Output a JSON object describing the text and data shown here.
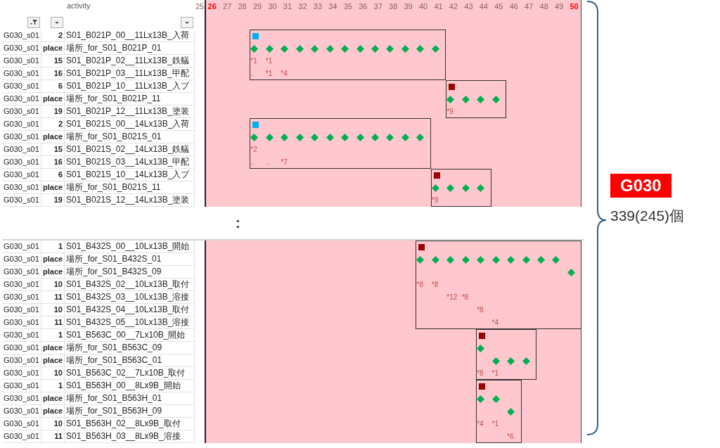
{
  "sheets": [
    {
      "columns": [
        {
          "filtered": true
        },
        {
          "filtered": false
        },
        {
          "title": "activity",
          "filtered": false
        }
      ],
      "days": [
        {
          "label": "25",
          "highlight": false
        },
        {
          "label": "26",
          "highlight": true
        },
        {
          "label": "27",
          "highlight": false
        },
        {
          "label": "28",
          "highlight": false
        },
        {
          "label": "29",
          "highlight": false
        },
        {
          "label": "30",
          "highlight": false
        },
        {
          "label": "31",
          "highlight": false
        },
        {
          "label": "32",
          "highlight": false
        },
        {
          "label": "33",
          "highlight": false
        },
        {
          "label": "34",
          "highlight": false
        },
        {
          "label": "35",
          "highlight": false
        },
        {
          "label": "36",
          "highlight": false
        },
        {
          "label": "37",
          "highlight": false
        },
        {
          "label": "38",
          "highlight": false
        },
        {
          "label": "39",
          "highlight": false
        },
        {
          "label": "40",
          "highlight": false
        },
        {
          "label": "41",
          "highlight": false
        },
        {
          "label": "42",
          "highlight": false
        },
        {
          "label": "43",
          "highlight": false
        },
        {
          "label": "44",
          "highlight": false
        },
        {
          "label": "45",
          "highlight": false
        },
        {
          "label": "46",
          "highlight": false
        },
        {
          "label": "47",
          "highlight": false
        },
        {
          "label": "48",
          "highlight": false
        },
        {
          "label": "49",
          "highlight": false
        },
        {
          "label": "50",
          "highlight": true
        }
      ],
      "groups": [
        {
          "rows": [
            {
              "id": "G030_s01",
              "number": "2",
              "activity": "S01_B021P_00__11Lx13B_入荷",
              "cells": [
                null,
                null,
                null,
                null,
                {
                  "kind": "square",
                  "color": "#00b0f0"
                }
              ]
            },
            {
              "id": "G030_s01",
              "number": "place",
              "activity": "場所_for_S01_B021P_01",
              "cells": [
                null,
                null,
                null,
                null,
                {
                  "kind": "diamond"
                },
                {
                  "kind": "diamond"
                },
                {
                  "kind": "diamond"
                },
                {
                  "kind": "diamond"
                },
                {
                  "kind": "diamond"
                },
                {
                  "kind": "diamond"
                },
                {
                  "kind": "diamond"
                },
                {
                  "kind": "diamond"
                },
                {
                  "kind": "diamond"
                },
                {
                  "kind": "diamond"
                },
                {
                  "kind": "diamond"
                },
                {
                  "kind": "diamond"
                },
                {
                  "kind": "diamond"
                }
              ]
            },
            {
              "id": "G030_s01",
              "number": "15",
              "activity": "S01_B021P_02__11Lx13B_鉄艤",
              "cells": [
                null,
                null,
                null,
                null,
                {
                  "kind": "note",
                  "text": "*1"
                },
                {
                  "kind": "note",
                  "text": "*1"
                }
              ]
            },
            {
              "id": "G030_s01",
              "number": "16",
              "activity": "S01_B021P_03__11Lx13B_甲配",
              "cells": [
                null,
                null,
                null,
                null,
                {
                  "kind": "note",
                  "text": ".."
                },
                {
                  "kind": "note",
                  "text": "*1"
                },
                {
                  "kind": "note",
                  "text": "*4"
                }
              ]
            }
          ]
        },
        {
          "rows": [
            {
              "id": "G030_s01",
              "number": "6",
              "activity": "S01_B021P_10__11Lx13B_入ブ",
              "cells": [
                null,
                null,
                null,
                null,
                null,
                null,
                null,
                null,
                null,
                null,
                null,
                null,
                null,
                null,
                null,
                null,
                null,
                {
                  "kind": "square",
                  "color": "#990000"
                }
              ]
            },
            {
              "id": "G030_s01",
              "number": "place",
              "activity": "場所_for_S01_B021P_11",
              "cells": [
                null,
                null,
                null,
                null,
                null,
                null,
                null,
                null,
                null,
                null,
                null,
                null,
                null,
                null,
                null,
                null,
                null,
                {
                  "kind": "diamond"
                },
                {
                  "kind": "diamond"
                },
                {
                  "kind": "diamond"
                },
                {
                  "kind": "diamond"
                }
              ]
            },
            {
              "id": "G030_s01",
              "number": "19",
              "activity": "S01_B021P_12__11Lx13B_塗装",
              "cells": [
                null,
                null,
                null,
                null,
                null,
                null,
                null,
                null,
                null,
                null,
                null,
                null,
                null,
                null,
                null,
                null,
                null,
                {
                  "kind": "note",
                  "text": "*9"
                }
              ]
            }
          ]
        },
        {
          "rows": [
            {
              "id": "G030_s01",
              "number": "2",
              "activity": "S01_B021S_00__14Lx13B_入荷",
              "cells": [
                null,
                null,
                null,
                null,
                {
                  "kind": "square",
                  "color": "#00b0f0"
                }
              ]
            },
            {
              "id": "G030_s01",
              "number": "place",
              "activity": "場所_for_S01_B021S_01",
              "cells": [
                null,
                null,
                null,
                null,
                {
                  "kind": "diamond"
                },
                {
                  "kind": "diamond"
                },
                {
                  "kind": "diamond"
                },
                {
                  "kind": "diamond"
                },
                {
                  "kind": "diamond"
                },
                {
                  "kind": "diamond"
                },
                {
                  "kind": "diamond"
                },
                {
                  "kind": "diamond"
                },
                {
                  "kind": "diamond"
                },
                {
                  "kind": "diamond"
                },
                {
                  "kind": "diamond"
                },
                {
                  "kind": "diamond"
                }
              ]
            },
            {
              "id": "G030_s01",
              "number": "15",
              "activity": "S01_B021S_02__14Lx13B_鉄艤",
              "cells": [
                null,
                null,
                null,
                null,
                {
                  "kind": "note",
                  "text": "*2"
                }
              ]
            },
            {
              "id": "G030_s01",
              "number": "16",
              "activity": "S01_B021S_03__14Lx13B_甲配",
              "cells": [
                null,
                null,
                null,
                null,
                {
                  "kind": "note",
                  "text": ".."
                },
                {
                  "kind": "note",
                  "text": ".."
                },
                {
                  "kind": "note",
                  "text": "*7"
                }
              ]
            }
          ]
        },
        {
          "rows": [
            {
              "id": "G030_s01",
              "number": "6",
              "activity": "S01_B021S_10__14Lx13B_入ブ",
              "cells": [
                null,
                null,
                null,
                null,
                null,
                null,
                null,
                null,
                null,
                null,
                null,
                null,
                null,
                null,
                null,
                null,
                {
                  "kind": "square",
                  "color": "#990000"
                }
              ]
            },
            {
              "id": "G030_s01",
              "number": "place",
              "activity": "場所_for_S01_B021S_11",
              "cells": [
                null,
                null,
                null,
                null,
                null,
                null,
                null,
                null,
                null,
                null,
                null,
                null,
                null,
                null,
                null,
                null,
                {
                  "kind": "diamond"
                },
                {
                  "kind": "diamond"
                },
                {
                  "kind": "diamond"
                },
                {
                  "kind": "diamond"
                }
              ]
            },
            {
              "id": "G030_s01",
              "number": "19",
              "activity": "S01_B021S_12__14Lx13B_塗装",
              "cells": [
                null,
                null,
                null,
                null,
                null,
                null,
                null,
                null,
                null,
                null,
                null,
                null,
                null,
                null,
                null,
                null,
                {
                  "kind": "note",
                  "text": "*9"
                }
              ]
            }
          ]
        }
      ]
    },
    {
      "groups": [
        {
          "rows": [
            {
              "id": "G030_s01",
              "number": "1",
              "activity": "S01_B432S_00__10Lx13B_開始",
              "cells": [
                null,
                null,
                null,
                null,
                null,
                null,
                null,
                null,
                null,
                null,
                null,
                null,
                null,
                null,
                null,
                {
                  "kind": "square",
                  "color": "#990000"
                }
              ]
            },
            {
              "id": "G030_s01",
              "number": "place",
              "activity": "場所_for_S01_B432S_01",
              "cells": [
                null,
                null,
                null,
                null,
                null,
                null,
                null,
                null,
                null,
                null,
                null,
                null,
                null,
                null,
                null,
                {
                  "kind": "diamond"
                },
                {
                  "kind": "diamond"
                },
                {
                  "kind": "diamond"
                },
                {
                  "kind": "diamond"
                },
                {
                  "kind": "diamond"
                },
                {
                  "kind": "diamond"
                },
                {
                  "kind": "diamond"
                },
                {
                  "kind": "diamond"
                },
                {
                  "kind": "diamond"
                },
                {
                  "kind": "diamond"
                }
              ]
            },
            {
              "id": "G030_s01",
              "number": "place",
              "activity": "場所_for_S01_B432S_09",
              "cells": [
                null,
                null,
                null,
                null,
                null,
                null,
                null,
                null,
                null,
                null,
                null,
                null,
                null,
                null,
                null,
                null,
                null,
                null,
                null,
                null,
                null,
                null,
                null,
                null,
                null,
                {
                  "kind": "diamond"
                }
              ]
            },
            {
              "id": "G030_s01",
              "number": "10",
              "activity": "S01_B432S_02__10Lx13B_取付",
              "cells": [
                null,
                null,
                null,
                null,
                null,
                null,
                null,
                null,
                null,
                null,
                null,
                null,
                null,
                null,
                null,
                {
                  "kind": "note",
                  "text": "*8"
                },
                {
                  "kind": "note",
                  "text": "*8"
                }
              ]
            },
            {
              "id": "G030_s01",
              "number": "11",
              "activity": "S01_B432S_03__10Lx13B_溶接",
              "cells": [
                null,
                null,
                null,
                null,
                null,
                null,
                null,
                null,
                null,
                null,
                null,
                null,
                null,
                null,
                null,
                null,
                null,
                {
                  "kind": "note",
                  "text": "*12"
                },
                {
                  "kind": "note",
                  "text": "*8"
                }
              ]
            },
            {
              "id": "G030_s01",
              "number": "10",
              "activity": "S01_B432S_04__10Lx13B_取付",
              "cells": [
                null,
                null,
                null,
                null,
                null,
                null,
                null,
                null,
                null,
                null,
                null,
                null,
                null,
                null,
                null,
                null,
                null,
                null,
                null,
                {
                  "kind": "note",
                  "text": "*8"
                }
              ]
            },
            {
              "id": "G030_s01",
              "number": "11",
              "activity": "S01_B432S_05__10Lx13B_溶接",
              "cells": [
                null,
                null,
                null,
                null,
                null,
                null,
                null,
                null,
                null,
                null,
                null,
                null,
                null,
                null,
                null,
                null,
                null,
                null,
                null,
                null,
                {
                  "kind": "note",
                  "text": "*4"
                }
              ]
            }
          ]
        },
        {
          "rows": [
            {
              "id": "G030_s01",
              "number": "1",
              "activity": "S01_B563C_00__7Lx10B_開始",
              "cells": [
                null,
                null,
                null,
                null,
                null,
                null,
                null,
                null,
                null,
                null,
                null,
                null,
                null,
                null,
                null,
                null,
                null,
                null,
                null,
                {
                  "kind": "square",
                  "color": "#990000"
                }
              ]
            },
            {
              "id": "G030_s01",
              "number": "place",
              "activity": "場所_for_S01_B563C_09",
              "cells": [
                null,
                null,
                null,
                null,
                null,
                null,
                null,
                null,
                null,
                null,
                null,
                null,
                null,
                null,
                null,
                null,
                null,
                null,
                null,
                {
                  "kind": "diamond"
                }
              ]
            },
            {
              "id": "G030_s01",
              "number": "place",
              "activity": "場所_for_S01_B563C_01",
              "cells": [
                null,
                null,
                null,
                null,
                null,
                null,
                null,
                null,
                null,
                null,
                null,
                null,
                null,
                null,
                null,
                null,
                null,
                null,
                null,
                null,
                {
                  "kind": "diamond"
                },
                {
                  "kind": "diamond"
                },
                {
                  "kind": "diamond"
                }
              ]
            },
            {
              "id": "G030_s01",
              "number": "10",
              "activity": "S01_B563C_02__7Lx10B_取付",
              "cells": [
                null,
                null,
                null,
                null,
                null,
                null,
                null,
                null,
                null,
                null,
                null,
                null,
                null,
                null,
                null,
                null,
                null,
                null,
                null,
                {
                  "kind": "note",
                  "text": "*8"
                },
                {
                  "kind": "note",
                  "text": "*1"
                }
              ]
            }
          ]
        },
        {
          "rows": [
            {
              "id": "G030_s01",
              "number": "1",
              "activity": "S01_B563H_00__8Lx9B_開始",
              "cells": [
                null,
                null,
                null,
                null,
                null,
                null,
                null,
                null,
                null,
                null,
                null,
                null,
                null,
                null,
                null,
                null,
                null,
                null,
                null,
                {
                  "kind": "square",
                  "color": "#990000"
                }
              ]
            },
            {
              "id": "G030_s01",
              "number": "place",
              "activity": "場所_for_S01_B563H_01",
              "cells": [
                null,
                null,
                null,
                null,
                null,
                null,
                null,
                null,
                null,
                null,
                null,
                null,
                null,
                null,
                null,
                null,
                null,
                null,
                null,
                {
                  "kind": "diamond"
                },
                {
                  "kind": "diamond"
                }
              ]
            },
            {
              "id": "G030_s01",
              "number": "place",
              "activity": "場所_for_S01_B563H_09",
              "cells": [
                null,
                null,
                null,
                null,
                null,
                null,
                null,
                null,
                null,
                null,
                null,
                null,
                null,
                null,
                null,
                null,
                null,
                null,
                null,
                null,
                null,
                {
                  "kind": "diamond"
                }
              ]
            },
            {
              "id": "G030_s01",
              "number": "10",
              "activity": "S01_B563H_02__8Lx9B_取付",
              "cells": [
                null,
                null,
                null,
                null,
                null,
                null,
                null,
                null,
                null,
                null,
                null,
                null,
                null,
                null,
                null,
                null,
                null,
                null,
                null,
                {
                  "kind": "note",
                  "text": "*4"
                },
                {
                  "kind": "note",
                  "text": "*1"
                }
              ]
            },
            {
              "id": "G030_s01",
              "number": "11",
              "activity": "S01_B563H_03__8Lx9B_溶接",
              "cells": [
                null,
                null,
                null,
                null,
                null,
                null,
                null,
                null,
                null,
                null,
                null,
                null,
                null,
                null,
                null,
                null,
                null,
                null,
                null,
                null,
                null,
                {
                  "kind": "note",
                  "text": "*6"
                }
              ]
            }
          ]
        }
      ]
    }
  ],
  "separator": ":",
  "summary": {
    "badge": "G030",
    "count": "339(245)個"
  }
}
